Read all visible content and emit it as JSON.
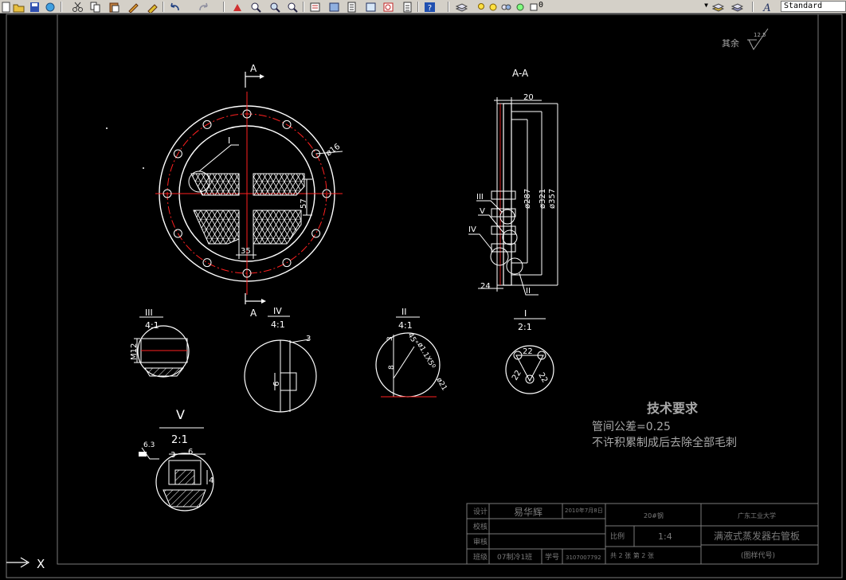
{
  "toolbar": {
    "layer_value": "0",
    "text_style_value": "Standard",
    "icons": [
      "new-icon",
      "open-icon",
      "save-icon",
      "plot-icon",
      "preview-icon",
      "cut-icon",
      "copy-icon",
      "paste-icon",
      "match-properties-icon",
      "undo-icon",
      "redo-icon",
      "pan-icon",
      "zoom-realtime-icon",
      "zoom-window-icon",
      "zoom-previous-icon",
      "properties-icon",
      "design-center-icon",
      "tool-palettes-icon",
      "sheet-set-icon",
      "markup-icon",
      "calculator-icon",
      "help-icon",
      "layer-manager-icon",
      "layer-previous-icon",
      "text-style-icon"
    ]
  },
  "drawing": {
    "finish_symbol_label": "其余",
    "finish_value": "12.5",
    "main_view": {
      "section_label_top": "A",
      "section_label_bottom": "A",
      "detail_I_callout": "I",
      "hole_dim": "ø16",
      "dim_35": "35",
      "dim_57": "57"
    },
    "section_view": {
      "title": "A-A",
      "dim_20": "20",
      "dim_d287": "ø287",
      "dim_d321": "ø321",
      "dim_d357": "ø357",
      "dim_24": "24",
      "callout_III": "III",
      "callout_V": "V",
      "callout_IV": "IV",
      "callout_II": "II"
    },
    "detail_III": {
      "label": "III",
      "scale": "4:1",
      "dim": "M12"
    },
    "detail_IV": {
      "label": "IV",
      "scale": "4:1",
      "dim_3": "3",
      "dim_6": "6"
    },
    "detail_II": {
      "label": "II",
      "scale": "4:1",
      "dim_3": "3",
      "dim_8": "8",
      "dim_angle": "45°",
      "dim_chamfer": "ø1.1X5º",
      "dim_d21": "ø21"
    },
    "detail_I": {
      "label": "I",
      "scale": "2:1",
      "dim_22": "22",
      "dim_a": "22",
      "dim_b": "22"
    },
    "detail_V": {
      "label": "V",
      "scale": "2:1",
      "roughness": "6.3",
      "dim_3": "3",
      "dim_6": "6",
      "dim_4": "4"
    },
    "tech_requirements": {
      "title": "技术要求",
      "line1": "管间公差=0.25",
      "line2": "不许积累制成后去除全部毛刺"
    },
    "title_block": {
      "label_design": "设计",
      "designer": "易华辉",
      "date": "2010年7月8日",
      "label_review": "校核",
      "label_audit": "审核",
      "label_class": "班级",
      "class_value": "07制冷1班",
      "label_student_no": "学号",
      "student_no": "3107007792",
      "material": "20#钢",
      "label_scale": "比例",
      "scale": "1:4",
      "sheet_info": "共 2 张    第 2 张",
      "university": "广东工业大学",
      "part_name": "满液式蒸发器右管板",
      "drawing_code": "(图样代号)"
    },
    "ucs_x_label": "X"
  },
  "colors": {
    "background": "#000000",
    "line_white": "#ffffff",
    "center_red": "#ff2020",
    "text_gray": "#a8a8a8",
    "frame_gray": "#7a7a7a",
    "toolbar_bg": "#d4d0c8"
  }
}
